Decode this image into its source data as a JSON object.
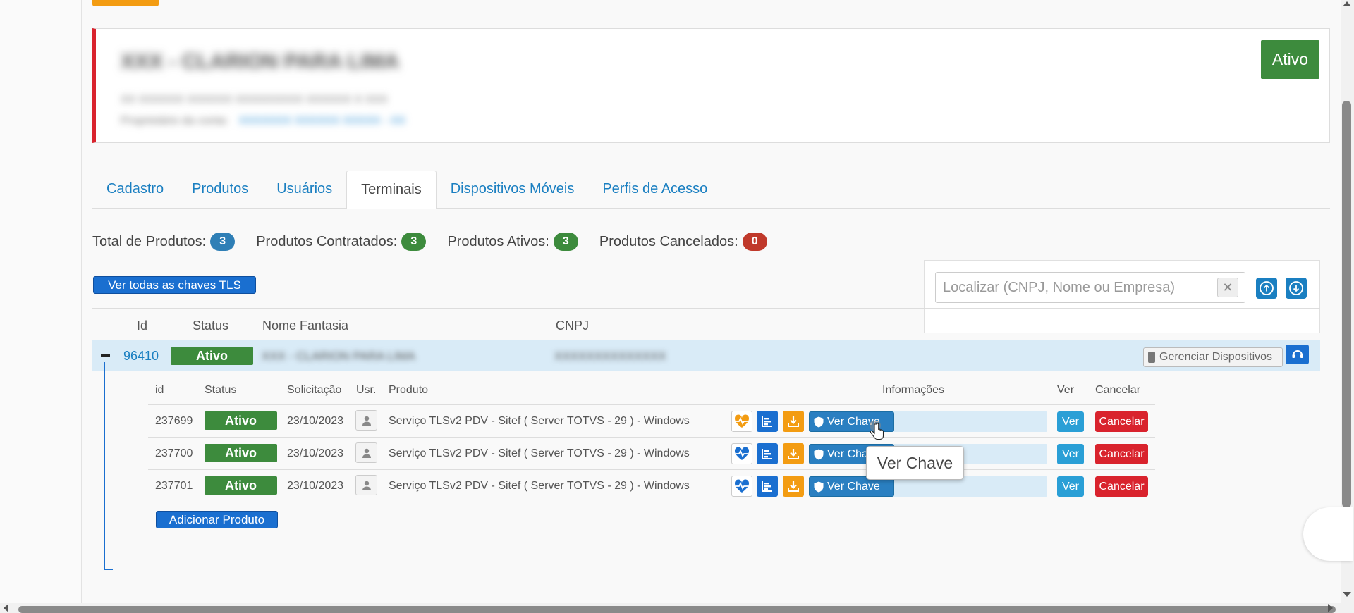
{
  "client": {
    "title": "XXX - CLARION PARA LIMA",
    "subtitle": "XX XXXXXX XXXXXX XXXXXXXXX XXXXXX X XXX",
    "owner_label": "Proprietário da conta:",
    "owner_value": "XXXXXXX XXXXXX XXXXX - XX",
    "status": "Ativo"
  },
  "tabs": [
    {
      "label": "Cadastro"
    },
    {
      "label": "Produtos"
    },
    {
      "label": "Usuários"
    },
    {
      "label": "Terminais",
      "active": true
    },
    {
      "label": "Dispositivos Móveis"
    },
    {
      "label": "Perfis de Acesso"
    }
  ],
  "counts": {
    "total_label": "Total de Produtos:",
    "total": "3",
    "contracted_label": "Produtos Contratados:",
    "contracted": "3",
    "active_label": "Produtos Ativos:",
    "active": "3",
    "cancelled_label": "Produtos Cancelados:",
    "cancelled": "0"
  },
  "tls_all_label": "Ver todas as chaves TLS",
  "search": {
    "placeholder": "Localizar (CNPJ, Nome ou Empresa)",
    "clear": "✕"
  },
  "main_table": {
    "headers": {
      "id": "Id",
      "status": "Status",
      "name": "Nome Fantasia",
      "cnpj": "CNPJ"
    },
    "row": {
      "id": "96410",
      "status": "Ativo",
      "name": "XXX - CLARION PARA LIMA",
      "cnpj": "XXXXXXXXXXXXXX",
      "devices_label": "Gerenciar Dispositivos"
    }
  },
  "sub_table": {
    "headers": {
      "id": "id",
      "status": "Status",
      "request": "Solicitação",
      "user": "Usr.",
      "product": "Produto",
      "info": "Informações",
      "view": "Ver",
      "cancel": "Cancelar"
    },
    "rows": [
      {
        "id": "237699",
        "status": "Ativo",
        "date": "23/10/2023",
        "product": "Serviço TLSv2 PDV - Sitef ( Server TOTVS - 29 ) - Windows",
        "key_label": "Ver Chave",
        "view_label": "Ver",
        "cancel_label": "Cancelar",
        "health": "warning"
      },
      {
        "id": "237700",
        "status": "Ativo",
        "date": "23/10/2023",
        "product": "Serviço TLSv2 PDV - Sitef ( Server TOTVS - 29 ) - Windows",
        "key_label": "Ver Chave",
        "view_label": "Ver",
        "cancel_label": "Cancelar",
        "health": "ok"
      },
      {
        "id": "237701",
        "status": "Ativo",
        "date": "23/10/2023",
        "product": "Serviço TLSv2 PDV - Sitef ( Server TOTVS - 29 ) - Windows",
        "key_label": "Ver Chave",
        "view_label": "Ver",
        "cancel_label": "Cancelar",
        "health": "ok"
      }
    ]
  },
  "add_product_label": "Adicionar Produto",
  "tooltip": "Ver Chave",
  "colors": {
    "accent_blue": "#1a6fd0",
    "link_blue": "#1a7fc1",
    "success": "#3d8b3d",
    "danger": "#d9232d",
    "warning": "#f39c12"
  }
}
